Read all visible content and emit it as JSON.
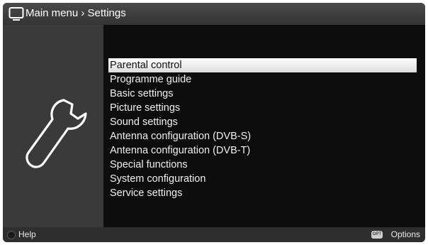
{
  "header": {
    "icon": "tv-icon",
    "title": "Main menu › Settings"
  },
  "sidebar": {
    "icon": "wrench-icon"
  },
  "menu": {
    "selected_index": 0,
    "items": [
      {
        "label": "Parental control"
      },
      {
        "label": "Programme guide"
      },
      {
        "label": "Basic settings"
      },
      {
        "label": "Picture settings"
      },
      {
        "label": "Sound settings"
      },
      {
        "label": "Antenna configuration (DVB-S)"
      },
      {
        "label": "Antenna configuration (DVB-T)"
      },
      {
        "label": "Special functions"
      },
      {
        "label": "System configuration"
      },
      {
        "label": "Service settings"
      }
    ]
  },
  "footer": {
    "help_label": "Help",
    "options_badge": "OPT",
    "options_label": "Options"
  },
  "colors": {
    "frame": "#383838",
    "content_bg": "#0d0d0d",
    "highlight": "#f2f2f2"
  }
}
